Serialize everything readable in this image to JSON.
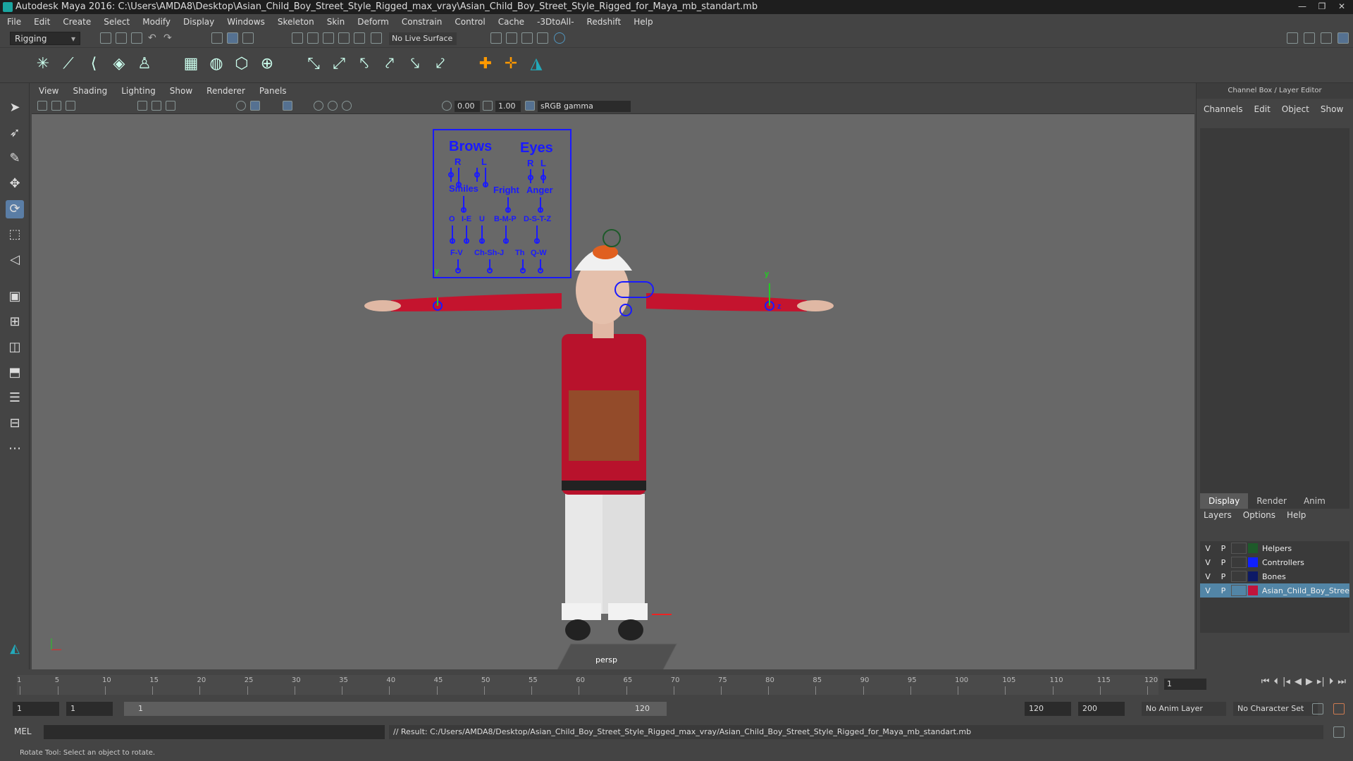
{
  "window": {
    "title": "Autodesk Maya 2016: C:\\Users\\AMDA8\\Desktop\\Asian_Child_Boy_Street_Style_Rigged_max_vray\\Asian_Child_Boy_Street_Style_Rigged_for_Maya_mb_standart.mb"
  },
  "menu": [
    "File",
    "Edit",
    "Create",
    "Select",
    "Modify",
    "Display",
    "Windows",
    "Skeleton",
    "Skin",
    "Deform",
    "Constrain",
    "Control",
    "Cache",
    "-3DtoAll-",
    "Redshift",
    "Help"
  ],
  "shelf": {
    "mode": "Rigging",
    "live_surface": "No Live Surface"
  },
  "viewport": {
    "menu": [
      "View",
      "Shading",
      "Lighting",
      "Show",
      "Renderer",
      "Panels"
    ],
    "exposure": "0.00",
    "gamma": "1.00",
    "color_space": "sRGB gamma",
    "camera": "persp"
  },
  "face_rig": {
    "brows": "Brows",
    "eyes": "Eyes",
    "r": "R",
    "l": "L",
    "smiles": "Smiles",
    "fright": "Fright",
    "anger": "Anger",
    "o": "O",
    "ie": "I-E",
    "u": "U",
    "bmp": "B-M-P",
    "dstz": "D-S-T-Z",
    "fv": "F-V",
    "chshj": "Ch-Sh-J",
    "th": "Th",
    "qw": "Q-W",
    "y_left": "y",
    "y_right": "y",
    "z": "z"
  },
  "channel_box": {
    "title": "Channel Box / Layer Editor",
    "menu": [
      "Channels",
      "Edit",
      "Object",
      "Show"
    ],
    "tabs": [
      "Display",
      "Render",
      "Anim"
    ],
    "layer_menu": [
      "Layers",
      "Options",
      "Help"
    ],
    "layers": [
      {
        "v": "V",
        "p": "P",
        "name": "Helpers",
        "color": "#1e5a2a"
      },
      {
        "v": "V",
        "p": "P",
        "name": "Controllers",
        "color": "#1020ff"
      },
      {
        "v": "V",
        "p": "P",
        "name": "Bones",
        "color": "#0d1a66"
      },
      {
        "v": "V",
        "p": "P",
        "name": "Asian_Child_Boy_Stree",
        "color": "#c0143c"
      }
    ]
  },
  "timeline": {
    "ticks": [
      "1",
      "5",
      "10",
      "15",
      "20",
      "25",
      "30",
      "35",
      "40",
      "45",
      "50",
      "55",
      "60",
      "65",
      "70",
      "75",
      "80",
      "85",
      "90",
      "95",
      "100",
      "105",
      "110",
      "115",
      "120"
    ],
    "current_frame": "1"
  },
  "range": {
    "start": "1",
    "playback_start": "1",
    "slider_start": "1",
    "slider_end": "120",
    "playback_end": "120",
    "end": "200",
    "anim_layer": "No Anim Layer",
    "char_set": "No Character Set"
  },
  "command": {
    "lang": "MEL",
    "result": "// Result: C:/Users/AMDA8/Desktop/Asian_Child_Boy_Street_Style_Rigged_max_vray/Asian_Child_Boy_Street_Style_Rigged_for_Maya_mb_standart.mb"
  },
  "help": "Rotate Tool: Select an object to rotate.",
  "colors": {
    "accent": "#5285a6",
    "rig": "#1a1aff"
  }
}
